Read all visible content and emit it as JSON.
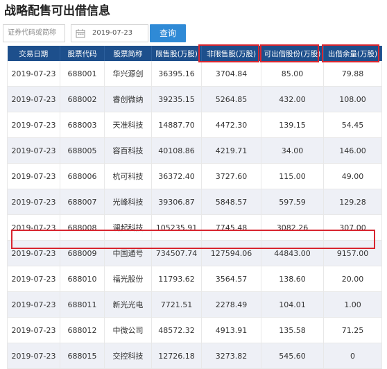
{
  "title": "战略配售可出借信息",
  "search": {
    "code_placeholder": "证券代码或简称",
    "date_value": "2019-07-23",
    "query_label": "查询"
  },
  "table": {
    "headers": [
      "交易日期",
      "股票代码",
      "股票简称",
      "限售股(万股)",
      "非限售股(万股)",
      "可出借股份(万股)",
      "出借余量(万股)"
    ],
    "rows": [
      [
        "2019-07-23",
        "688001",
        "华兴源创",
        "36395.16",
        "3704.84",
        "85.00",
        "79.88"
      ],
      [
        "2019-07-23",
        "688002",
        "睿创微纳",
        "39235.15",
        "5264.85",
        "432.00",
        "108.00"
      ],
      [
        "2019-07-23",
        "688003",
        "天准科技",
        "14887.70",
        "4472.30",
        "139.15",
        "54.45"
      ],
      [
        "2019-07-23",
        "688005",
        "容百科技",
        "40108.86",
        "4219.71",
        "34.00",
        "146.00"
      ],
      [
        "2019-07-23",
        "688006",
        "杭可科技",
        "36372.40",
        "3727.60",
        "115.00",
        "49.00"
      ],
      [
        "2019-07-23",
        "688007",
        "光峰科技",
        "39306.87",
        "5848.57",
        "597.59",
        "129.28"
      ],
      [
        "2019-07-23",
        "688008",
        "澜起科技",
        "105235.91",
        "7745.48",
        "3082.26",
        "307.00"
      ],
      [
        "2019-07-23",
        "688009",
        "中国通号",
        "734507.74",
        "127594.06",
        "44843.00",
        "9157.00"
      ],
      [
        "2019-07-23",
        "688010",
        "福光股份",
        "11793.62",
        "3564.57",
        "138.60",
        "20.00"
      ],
      [
        "2019-07-23",
        "688011",
        "新光光电",
        "7721.51",
        "2278.49",
        "104.01",
        "1.00"
      ],
      [
        "2019-07-23",
        "688012",
        "中微公司",
        "48572.32",
        "4913.91",
        "135.58",
        "71.25"
      ],
      [
        "2019-07-23",
        "688015",
        "交控科技",
        "12726.18",
        "3273.82",
        "545.60",
        "0"
      ]
    ]
  },
  "colors": {
    "header_bg": "#1d4f8c",
    "highlight_border": "#d8252f",
    "button_bg": "#2f8ad6"
  }
}
